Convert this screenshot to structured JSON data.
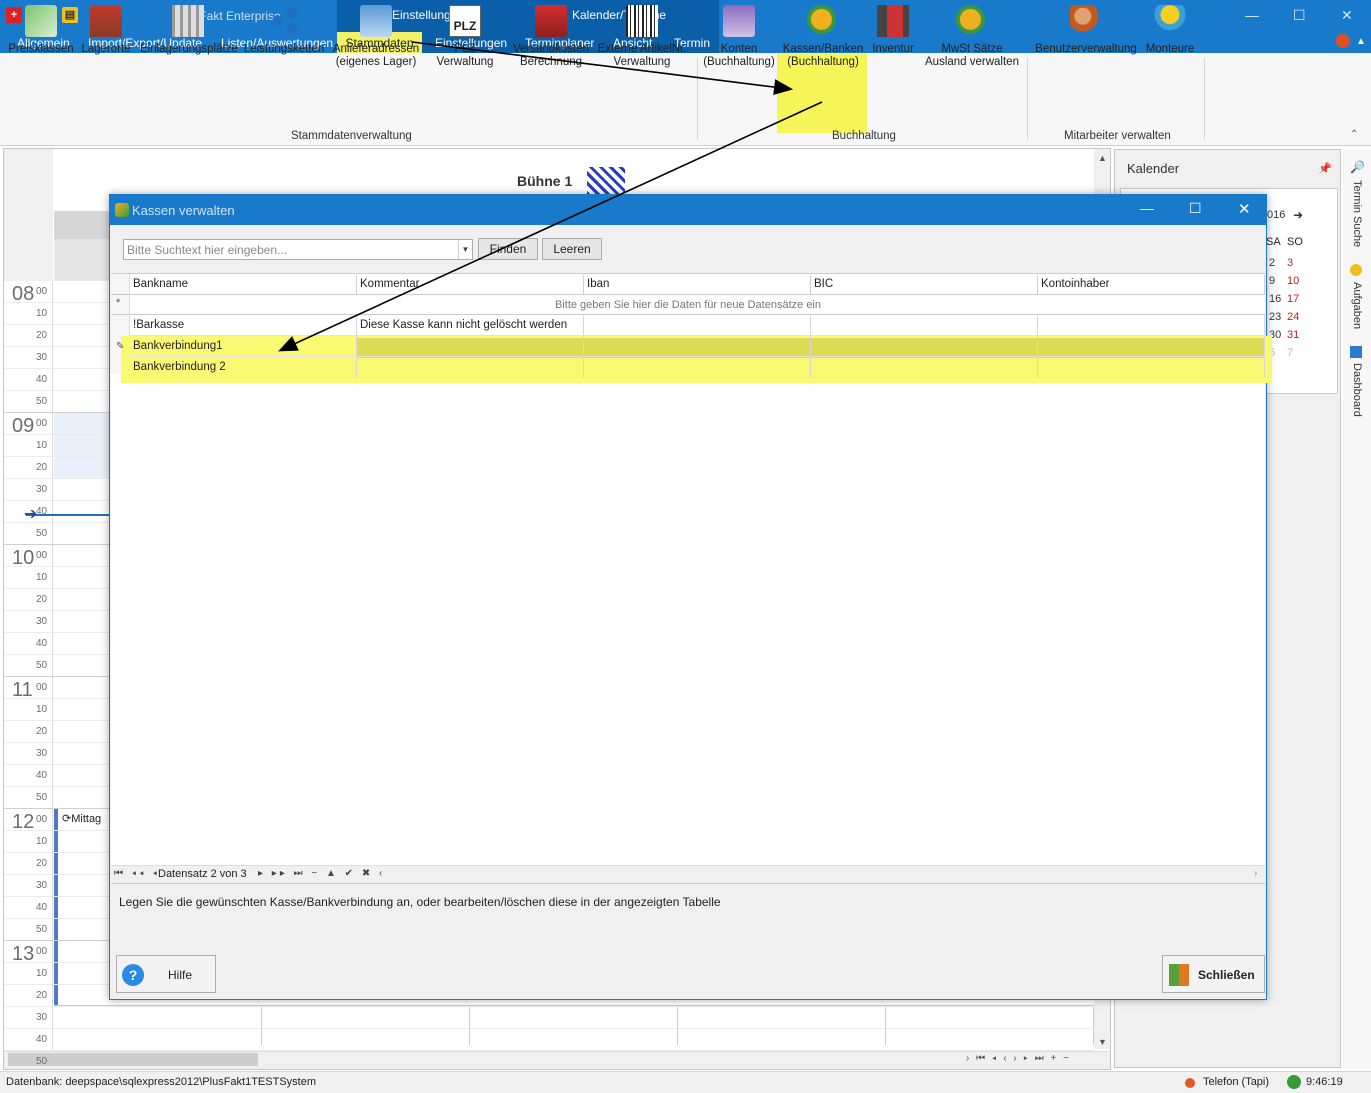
{
  "app": {
    "title": "PlusFakt Enterprise",
    "ctx_einstellungen": "Einstellungen",
    "ctx_kalender": "Kalender/Termine"
  },
  "menu": {
    "tabs": [
      "Allgemein",
      "Import/Export/Update",
      "Listen/Auswertungen",
      "Stammdaten",
      "Einstellungen",
      "Terminplaner",
      "Ansicht",
      "Termin"
    ]
  },
  "ribbon": {
    "items": [
      {
        "label": "Preisklassen",
        "icon": "price-class-icon"
      },
      {
        "label": "Lagerorte",
        "icon": "warehouse-icon"
      },
      {
        "label": "Einlagerungsplätze",
        "icon": "storage-rack-icon"
      },
      {
        "label": "Leistungsketten",
        "icon": "chain-icon"
      },
      {
        "label": "Anlieferadressen\n(eigenes Lager)",
        "icon": "delivery-address-icon"
      },
      {
        "label": "PLZ Verwaltung",
        "icon": "plz-icon"
      },
      {
        "label": "Versandkosten\nBerechnung",
        "icon": "shipping-truck-icon"
      },
      {
        "label": "Externe ArtikelNr.\nVerwaltung",
        "icon": "barcode-icon"
      },
      {
        "label": "Konten\n(Buchhaltung)",
        "icon": "bank-icon"
      },
      {
        "label": "Kassen/Banken\n(Buchhaltung)",
        "icon": "money-bag-icon"
      },
      {
        "label": "Inventur",
        "icon": "forklift-icon"
      },
      {
        "label": "MwSt Sätze\nAusland verwalten",
        "icon": "tax-money-icon"
      },
      {
        "label": "Benutzerverwaltung",
        "icon": "user-admin-icon"
      },
      {
        "label": "Monteure",
        "icon": "worker-icon"
      }
    ],
    "groups": [
      "Stammdatenverwaltung",
      "Buchhaltung",
      "Mitarbeiter verwalten"
    ]
  },
  "scheduler": {
    "resource": "Bühne 1",
    "hours": [
      "08",
      "09",
      "10",
      "11",
      "12",
      "13"
    ],
    "minutes": [
      "00",
      "10",
      "20",
      "30",
      "40",
      "50"
    ],
    "appointment": "Mittag"
  },
  "dialog": {
    "title": "Kassen verwalten",
    "search_placeholder": "Bitte Suchtext hier eingeben...",
    "find_label": "Finden",
    "clear_label": "Leeren",
    "columns": [
      "Bankname",
      "Kommentar",
      "Iban",
      "BIC",
      "Kontoinhaber"
    ],
    "new_row_hint": "Bitte geben Sie hier die Daten  für neue Datensätze ein",
    "rows": [
      [
        "!Barkasse",
        "Diese Kasse kann nicht gelöscht werden",
        "",
        "",
        ""
      ],
      [
        "Bankverbindung1",
        "",
        "",
        "",
        ""
      ],
      [
        "Bankverbindung 2",
        "",
        "",
        "",
        ""
      ]
    ],
    "navigator": "Datensatz 2 von 3",
    "info": "Legen Sie die gewünschten Kasse/Bankverbindung an, oder bearbeiten/löschen diese in der angezeigten Tabelle",
    "help_label": "Hilfe",
    "close_label": "Schließen"
  },
  "calendar": {
    "title": "Kalender",
    "year_frag": "016",
    "day_headers": [
      "SA",
      "SO"
    ],
    "rows": [
      [
        "2",
        "3"
      ],
      [
        "9",
        "10"
      ],
      [
        "16",
        "17"
      ],
      [
        "23",
        "24"
      ],
      [
        "30",
        "31"
      ],
      [
        "6",
        "7"
      ]
    ]
  },
  "side_tabs": [
    "Termin Suche",
    "Aufgaben",
    "Dashboard"
  ],
  "status": {
    "db": "Datenbank: deepspace\\sqlexpress2012\\PlusFakt1TESTSystem",
    "phone": "Telefon (Tapi)",
    "time": "9:46:19"
  },
  "colors": {
    "accent": "#1979ca",
    "highlight": "#f5f55a",
    "arrow": "#000000"
  }
}
